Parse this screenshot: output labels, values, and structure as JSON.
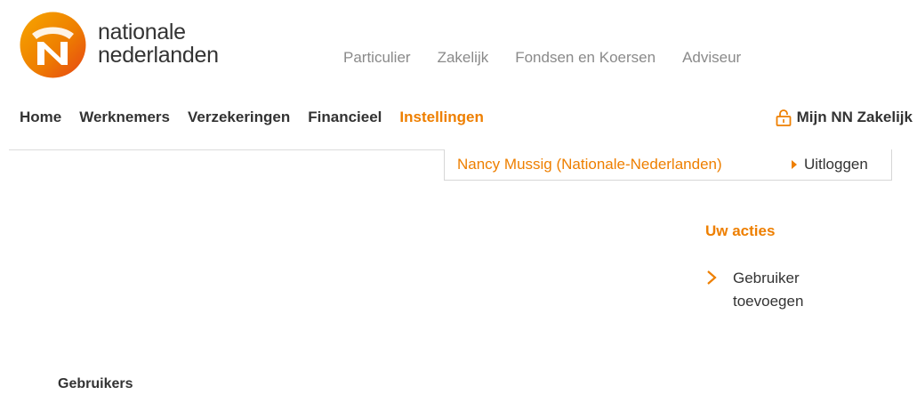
{
  "brand": {
    "line1": "nationale",
    "line2": "nederlanden",
    "colors": {
      "orange": "#ee7f00",
      "orange_dark": "#e64415",
      "text": "#333333",
      "muted": "#8a8a8a"
    }
  },
  "topnav": [
    {
      "label": "Particulier"
    },
    {
      "label": "Zakelijk"
    },
    {
      "label": "Fondsen en Koersen"
    },
    {
      "label": "Adviseur"
    }
  ],
  "mainnav": [
    {
      "label": "Home",
      "active": false
    },
    {
      "label": "Werknemers",
      "active": false
    },
    {
      "label": "Verzekeringen",
      "active": false
    },
    {
      "label": "Financieel",
      "active": false
    },
    {
      "label": "Instellingen",
      "active": true
    }
  ],
  "account": {
    "label": "Mijn NN Zakelijk",
    "icon": "lock-icon"
  },
  "userbar": {
    "user": "Nancy Mussig (Nationale-Nederlanden)",
    "logout": "Uitloggen"
  },
  "actions": {
    "title": "Uw acties",
    "items": [
      {
        "label": "Gebruiker toevoegen",
        "icon": "chevron-right-icon"
      }
    ]
  },
  "section": {
    "title": "Gebruikers"
  }
}
